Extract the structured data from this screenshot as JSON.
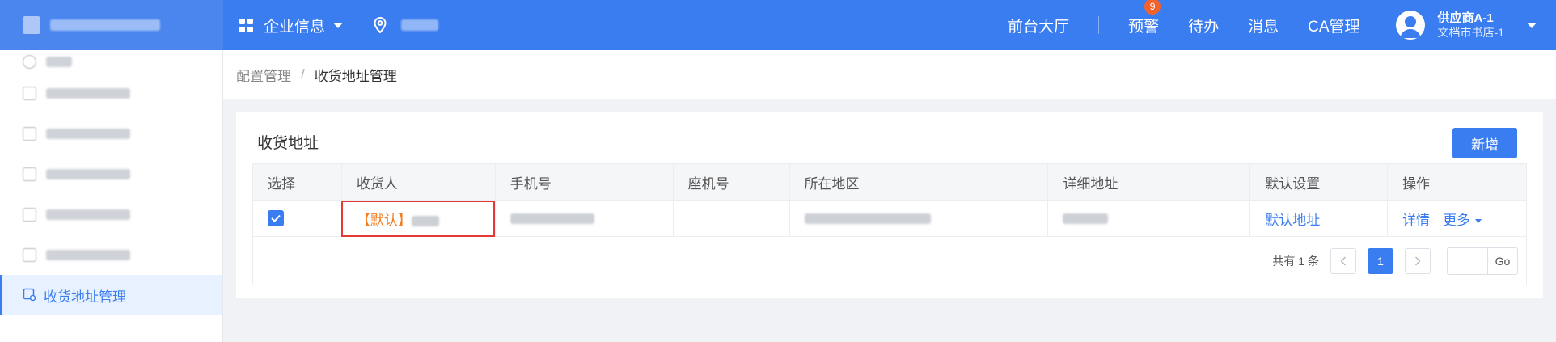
{
  "header": {
    "platform_name": "",
    "apps_label": "企业信息",
    "location": "",
    "nav": {
      "hall": "前台大厅",
      "warning": "预警",
      "warning_count": "9",
      "todo": "待办",
      "messages": "消息",
      "ca": "CA管理"
    },
    "user": {
      "name": "供应商A-1",
      "org": "文档市书店-1"
    }
  },
  "sidebar": {
    "items": [
      {
        "label": ""
      },
      {
        "label": ""
      },
      {
        "label": ""
      },
      {
        "label": ""
      },
      {
        "label": ""
      },
      {
        "label": ""
      },
      {
        "label": "收货地址管理"
      }
    ]
  },
  "breadcrumb": {
    "parent": "配置管理",
    "separator": "/",
    "current": "收货地址管理"
  },
  "card": {
    "title": "收货地址",
    "add_button": "新增"
  },
  "table": {
    "headers": [
      "选择",
      "收货人",
      "手机号",
      "座机号",
      "所在地区",
      "详细地址",
      "默认设置",
      "操作"
    ],
    "rows": [
      {
        "selected": true,
        "default_tag": "【默认】",
        "receiver": "",
        "mobile": "",
        "landline": "",
        "region": "",
        "address": "",
        "default_setting": "默认地址",
        "detail": "详情",
        "more": "更多"
      }
    ]
  },
  "pagination": {
    "total_text": "共有 1 条",
    "current_page": "1",
    "go_label": "Go",
    "jump_value": ""
  },
  "colors": {
    "primary": "#3a7df0",
    "badge": "#f5612a",
    "default_tag": "#f57c1f",
    "highlight": "#e53935"
  }
}
